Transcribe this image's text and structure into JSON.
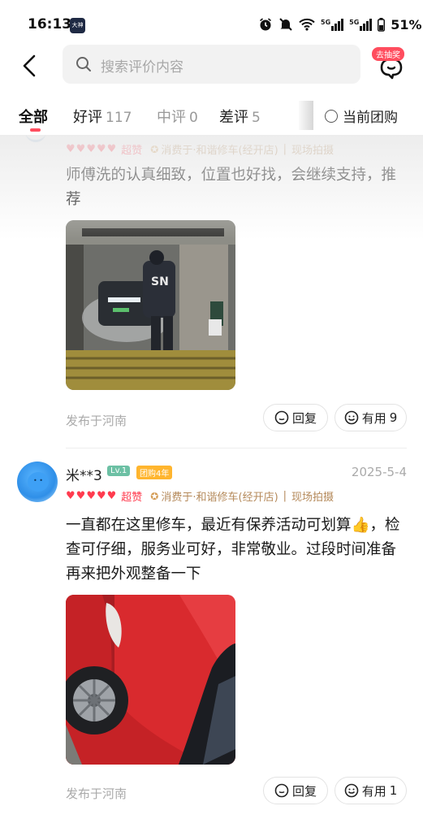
{
  "status_bar": {
    "time": "16:13",
    "app_badge": "大神",
    "network_1": "5G",
    "network_2": "5G",
    "battery": "51%"
  },
  "search": {
    "placeholder": "搜索评价内容",
    "lottery_badge": "去抽奖"
  },
  "tabs": {
    "all": "全部",
    "good": "好评",
    "good_count": "117",
    "mid": "中评",
    "mid_count": "0",
    "bad": "差评",
    "bad_count": "5",
    "group_filter": "当前团购"
  },
  "reviews": [
    {
      "rating_label": "超赞",
      "consumed_at": "消费于·和谐修车(经开店)",
      "live_photo": "现场拍摄",
      "text": "师傅洗的认真细致，位置也好找，会继续支持，推荐",
      "photo_text": "SN",
      "posted_from": "发布于河南",
      "reply_label": "回复",
      "useful_label": "有用",
      "useful_count": "9"
    },
    {
      "username": "米**3",
      "level": "Lv.1",
      "group_years": "团购4年",
      "date": "2025-5-4",
      "rating": 5,
      "rating_label": "超赞",
      "consumed_at": "消费于·和谐修车(经开店)",
      "live_photo": "现场拍摄",
      "text": "一直都在这里修车，最近有保养活动可划算👍，检查可仔细，服务业可好，非常敬业。过段时间准备再来把外观整备一下",
      "posted_from": "发布于河南",
      "reply_label": "回复",
      "useful_label": "有用",
      "useful_count": "1"
    }
  ],
  "colors": {
    "accent_red": "#ff3b4e",
    "level_badge": "#6cc0a4",
    "group_badge": "#ffb52e",
    "consume_text": "#b58a5b"
  }
}
